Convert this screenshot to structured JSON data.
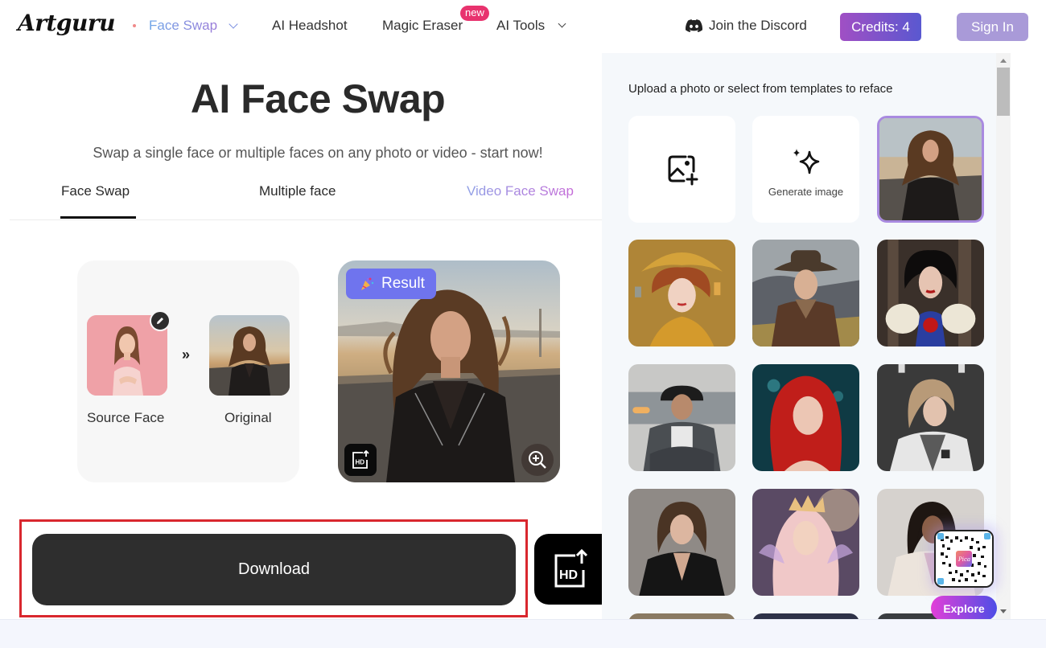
{
  "header": {
    "logo": "Artguru",
    "nav": [
      {
        "label": "Face Swap",
        "active": true,
        "has_dropdown": true
      },
      {
        "label": "AI Headshot"
      },
      {
        "label": "Magic Eraser",
        "badge": "new"
      },
      {
        "label": "AI Tools",
        "has_dropdown": true
      }
    ],
    "discord_label": "Join the Discord",
    "credits_label": "Credits: 4",
    "signin_label": "Sign In"
  },
  "main": {
    "title": "AI Face Swap",
    "subtitle": "Swap a single face or multiple faces on any photo or video - start now!",
    "tabs": [
      {
        "label": "Face Swap",
        "active": true
      },
      {
        "label": "Multiple face"
      },
      {
        "label": "Video Face Swap"
      }
    ],
    "swap": {
      "source_label": "Source Face",
      "arrows": "»",
      "original_label": "Original"
    },
    "result": {
      "badge_label": "Result"
    },
    "download_label": "Download"
  },
  "templates": {
    "instruction": "Upload a photo or select from templates to reface",
    "generate_label": "Generate image",
    "items": [
      {
        "name": "woman-biker-road",
        "selected": true
      },
      {
        "name": "klimt-redhead"
      },
      {
        "name": "cowboy"
      },
      {
        "name": "snow-white"
      },
      {
        "name": "man-beanie-car"
      },
      {
        "name": "redhead-mermaid"
      },
      {
        "name": "woman-racing-jacket"
      },
      {
        "name": "woman-black-blazer"
      },
      {
        "name": "fairy-pink-hair"
      },
      {
        "name": "woman-beige-coat"
      }
    ]
  },
  "widget": {
    "explore_label": "Explore",
    "qr_logo": "Pica"
  },
  "colors": {
    "accent_purple": "#a98ae0",
    "credits_gradient_start": "#a04fc4",
    "credits_gradient_end": "#5a58d0",
    "result_badge": "#6f74ee",
    "new_badge": "#e8336e",
    "highlight_frame": "#d9272e",
    "download_button": "#2e2e2e"
  }
}
